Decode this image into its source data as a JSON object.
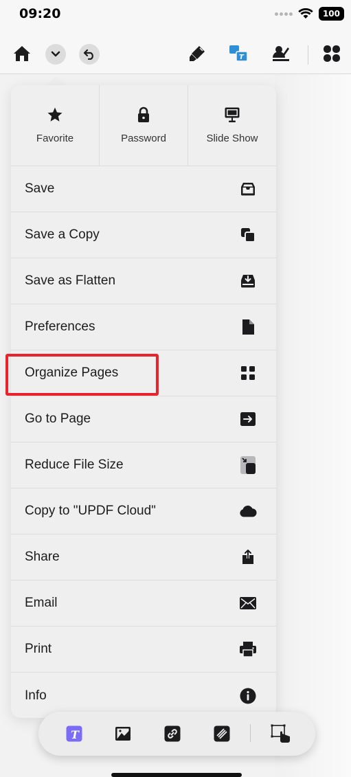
{
  "status_bar": {
    "time": "09:20",
    "battery": "100",
    "icons": [
      "signal-dots-icon",
      "wifi-icon",
      "battery-icon"
    ]
  },
  "toolbar": {
    "left_icons": [
      "home-icon",
      "chevron-down-icon",
      "undo-icon"
    ],
    "right_icons": [
      "highlighter-icon",
      "translate-icon",
      "sign-icon",
      "apps-grid-icon"
    ]
  },
  "menu": {
    "top_actions": [
      {
        "label": "Favorite",
        "icon": "star-icon"
      },
      {
        "label": "Password",
        "icon": "lock-icon"
      },
      {
        "label": "Slide Show",
        "icon": "presentation-icon"
      }
    ],
    "items": [
      {
        "label": "Save",
        "icon": "inbox-tray-icon"
      },
      {
        "label": "Save a Copy",
        "icon": "copy-icon"
      },
      {
        "label": "Save as Flatten",
        "icon": "download-tray-icon"
      },
      {
        "label": "Preferences",
        "icon": "document-icon"
      },
      {
        "label": "Organize Pages",
        "icon": "grid-icon",
        "highlighted": true
      },
      {
        "label": "Go to Page",
        "icon": "arrow-box-icon"
      },
      {
        "label": "Reduce File Size",
        "icon": "compress-icon"
      },
      {
        "label": "Copy to \"UPDF Cloud\"",
        "icon": "cloud-icon"
      },
      {
        "label": "Share",
        "icon": "share-icon"
      },
      {
        "label": "Email",
        "icon": "envelope-icon"
      },
      {
        "label": "Print",
        "icon": "printer-icon"
      },
      {
        "label": "Info",
        "icon": "info-icon"
      }
    ]
  },
  "bottom_toolbar": {
    "icons": [
      "text-box-icon",
      "image-icon",
      "link-icon",
      "stamp-icon",
      "select-area-icon"
    ],
    "accent_color": "#7b6cf6"
  },
  "colors": {
    "highlight": "#e8232b",
    "menu_background": "#efeff0"
  }
}
